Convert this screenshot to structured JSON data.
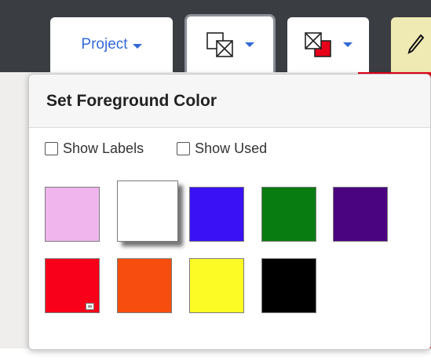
{
  "toolbar": {
    "project_label": "Project",
    "foreground_button": {
      "icon": "foreground-swap-icon"
    },
    "background_button": {
      "icon": "background-swap-icon",
      "accent": "#e7001a"
    },
    "tool_button": {
      "icon": "pencil-icon",
      "background": "#efe9b4"
    },
    "accent_color": "#3269d7"
  },
  "panel": {
    "title": "Set Foreground Color",
    "options": [
      {
        "label": "Show Labels",
        "checked": false
      },
      {
        "label": "Show Used",
        "checked": false
      }
    ],
    "swatches": [
      {
        "name": "pink",
        "color": "#efb5ec",
        "selected": false
      },
      {
        "name": "white",
        "color": "#ffffff",
        "selected": true
      },
      {
        "name": "blue",
        "color": "#3a10f5",
        "selected": false
      },
      {
        "name": "green",
        "color": "#087c10",
        "selected": false
      },
      {
        "name": "purple",
        "color": "#4a0480",
        "selected": false
      },
      {
        "name": "red",
        "color": "#f8001a",
        "selected": false,
        "badge": true
      },
      {
        "name": "orange",
        "color": "#f74d0e",
        "selected": false
      },
      {
        "name": "yellow",
        "color": "#fdfb26",
        "selected": false
      },
      {
        "name": "black",
        "color": "#000000",
        "selected": false
      }
    ]
  }
}
